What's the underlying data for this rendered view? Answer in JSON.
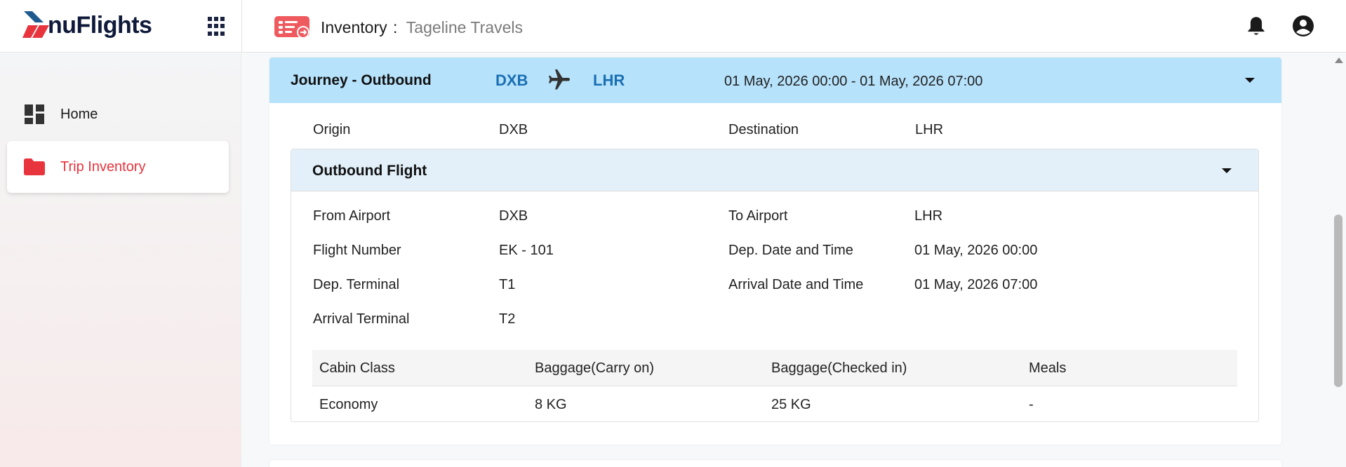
{
  "app": {
    "logo_text": "nuFlights",
    "title": "Inventory",
    "title_sep": ":",
    "subtitle": "Tageline Travels"
  },
  "sidebar": {
    "items": [
      {
        "label": "Home",
        "icon": "dashboard-icon"
      },
      {
        "label": "Trip Inventory",
        "icon": "folder-icon",
        "active": true
      }
    ]
  },
  "journey": {
    "title": "Journey - Outbound",
    "from": "DXB",
    "to": "LHR",
    "date_range": "01 May, 2026 00:00  - 01 May, 2026 07:00",
    "origin_label": "Origin",
    "origin_value": "DXB",
    "destination_label": "Destination",
    "destination_value": "LHR"
  },
  "flight": {
    "title": "Outbound Flight",
    "fields": {
      "from_airport_label": "From Airport",
      "from_airport_value": "DXB",
      "to_airport_label": "To Airport",
      "to_airport_value": "LHR",
      "flight_number_label": "Flight Number",
      "flight_number_value": "EK - 101",
      "dep_datetime_label": "Dep. Date and Time",
      "dep_datetime_value": "01 May, 2026 00:00",
      "dep_terminal_label": "Dep. Terminal",
      "dep_terminal_value": "T1",
      "arr_datetime_label": "Arrival Date and Time",
      "arr_datetime_value": "01 May, 2026 07:00",
      "arr_terminal_label": "Arrival Terminal",
      "arr_terminal_value": "T2"
    },
    "table": {
      "headers": [
        "Cabin Class",
        "Baggage(Carry on)",
        "Baggage(Checked in)",
        "Meals"
      ],
      "rows": [
        [
          "Economy",
          "8 KG",
          "25 KG",
          "-"
        ]
      ]
    }
  },
  "colors": {
    "brand_red": "#e8343d",
    "brand_navy": "#0f1a3a",
    "journey_header_bg": "#b6e2fb",
    "airport_code": "#1a6fb3",
    "flight_header_bg": "#e3f0f9"
  }
}
